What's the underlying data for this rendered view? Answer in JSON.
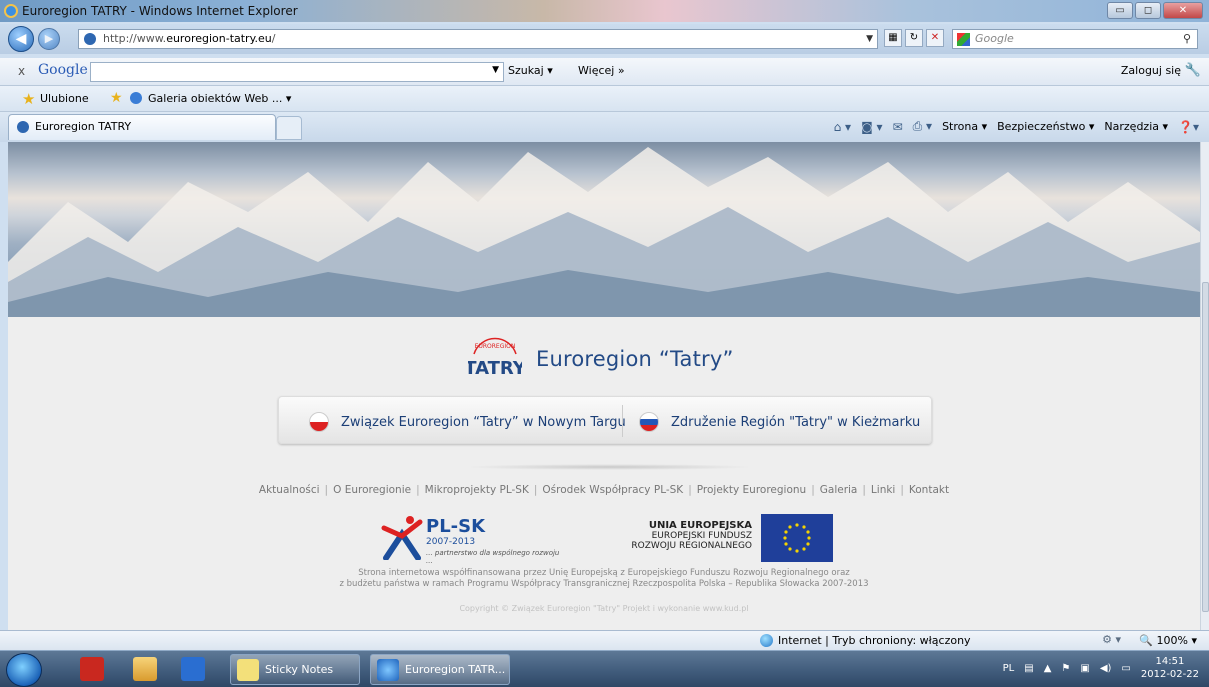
{
  "window": {
    "title": "Euroregion TATRY - Windows Internet Explorer",
    "controls": [
      "▭",
      "◻",
      "✕"
    ]
  },
  "address": {
    "url_prefix": "http://www.",
    "url_domain": "euroregion-tatry.eu",
    "url_suffix": "/",
    "search_placeholder": "Google"
  },
  "google_toolbar": {
    "close": "x",
    "logo": "Google",
    "search_button": "Szukaj",
    "more": "Więcej »",
    "login": "Zaloguj się"
  },
  "favorites_bar": {
    "favorites": "Ulubione",
    "gallery": "Galeria obiektów Web ..."
  },
  "tab": {
    "title": "Euroregion TATRY"
  },
  "command_bar": {
    "page": "Strona",
    "security": "Bezpieczeństwo",
    "tools": "Narzędzia"
  },
  "page": {
    "logo_arc": "EUROREGION",
    "logo_text": "TATRY",
    "title": "Euroregion “Tatry”",
    "lang_pl": "Związek Euroregion “Tatry” w Nowym Targu",
    "lang_sk": "Združenie Región \"Tatry\" w Kieżmarku",
    "menu": [
      "Aktualności",
      "O Euroregionie",
      "Mikroprojekty PL-SK",
      "Ośrodek Współpracy PL-SK",
      "Projekty Euroregionu",
      "Galeria",
      "Linki",
      "Kontakt"
    ],
    "plsk_title": "PL-SK",
    "plsk_years": "2007-2013",
    "plsk_sub": "... partnerstwo dla wspólnego rozwoju ...",
    "ue_line1": "UNIA EUROPEJSKA",
    "ue_line2": "EUROPEJSKI FUNDUSZ",
    "ue_line3": "ROZWOJU REGIONALNEGO",
    "funding_line1": "Strona internetowa współfinansowana przez Unię Europejską z Europejskiego Funduszu Rozwoju Regionalnego oraz",
    "funding_line2": "z budżetu państwa w ramach Programu Współpracy Transgranicznej Rzeczpospolita Polska – Republika Słowacka 2007-2013",
    "copyright": "Copyright © Związek Euroregion \"Tatry\" Projekt i wykonanie www.kud.pl"
  },
  "status_bar": {
    "zone": "Internet | Tryb chroniony: włączony",
    "zoom": "100%"
  },
  "taskbar": {
    "items": [
      "Sticky Notes",
      "Euroregion TATR..."
    ],
    "lang": "PL",
    "time": "14:51",
    "date": "2012-02-22"
  },
  "colors": {
    "brand_blue": "#234a86",
    "link_blue": "#1c3f77",
    "eu_blue": "#1f3f9a"
  }
}
